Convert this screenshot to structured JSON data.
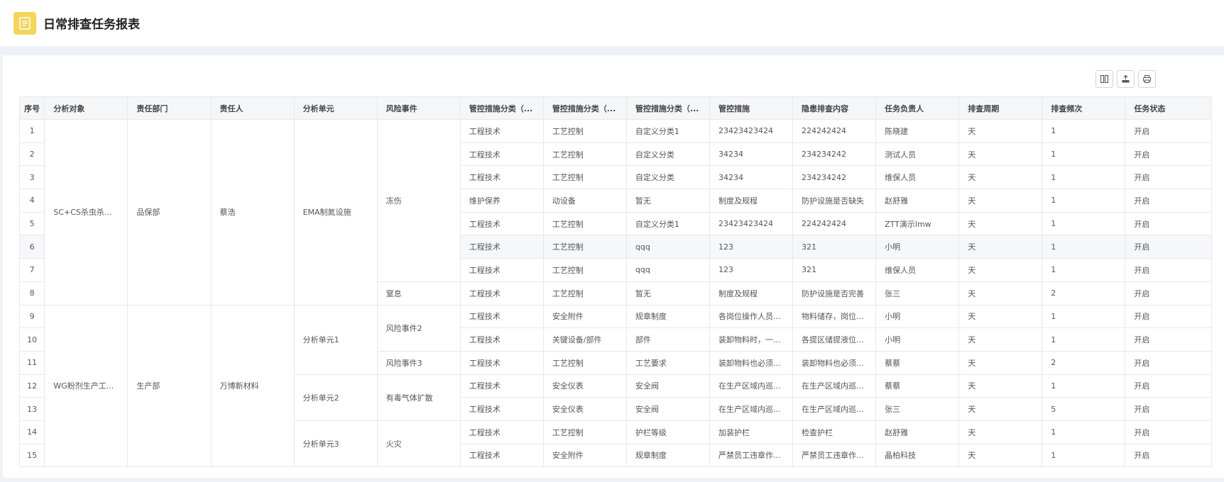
{
  "header": {
    "title": "日常排查任务报表",
    "icon": "report-document-icon"
  },
  "toolbar": {
    "buttons": [
      {
        "name": "column-settings-button",
        "icon": "columns-icon"
      },
      {
        "name": "export-button",
        "icon": "export-icon"
      },
      {
        "name": "print-button",
        "icon": "printer-icon"
      }
    ]
  },
  "colors": {
    "accent": "#f2d55a",
    "border": "#e6e8eb",
    "header_bg": "#f5f6f8",
    "highlight_row": "#f6f7fb"
  },
  "table": {
    "columns": [
      "序号",
      "分析对象",
      "责任部门",
      "责任人",
      "分析单元",
      "风险事件",
      "管控措施分类（...",
      "管控措施分类（...",
      "管控措施分类（...",
      "管控措施",
      "隐患排查内容",
      "任务负责人",
      "排查周期",
      "排查频次",
      "任务状态"
    ],
    "groups": [
      {
        "object": "SC+CS杀虫杀菌...",
        "dept": "品保部",
        "person": "蔡浩"
      },
      {
        "object": "WG粉剂生产工...",
        "dept": "生产部",
        "person": "万博新材料"
      }
    ],
    "units": [
      "EMA制氮设施",
      "分析单元1",
      "分析单元2",
      "分析单元3"
    ],
    "events": [
      "冻伤",
      "窒息",
      "风险事件2",
      "风险事件3",
      "有毒气体扩散",
      "火灾"
    ],
    "rows": [
      {
        "idx": "1",
        "c1": "工程技术",
        "c2": "工艺控制",
        "c3": "自定义分类1",
        "measure": "23423423424",
        "content": "224242424",
        "owner": "陈晓建",
        "cycle": "天",
        "freq": "1",
        "status": "开启"
      },
      {
        "idx": "2",
        "c1": "工程技术",
        "c2": "工艺控制",
        "c3": "自定义分类",
        "measure": "34234",
        "content": "234234242",
        "owner": "测试人员",
        "cycle": "天",
        "freq": "1",
        "status": "开启"
      },
      {
        "idx": "3",
        "c1": "工程技术",
        "c2": "工艺控制",
        "c3": "自定义分类",
        "measure": "34234",
        "content": "234234242",
        "owner": "维保人员",
        "cycle": "天",
        "freq": "1",
        "status": "开启"
      },
      {
        "idx": "4",
        "c1": "维护保养",
        "c2": "动设备",
        "c3": "暂无",
        "measure": "制度及规程",
        "content": "防护设施是否缺失",
        "owner": "赵舒雅",
        "cycle": "天",
        "freq": "1",
        "status": "开启"
      },
      {
        "idx": "5",
        "c1": "工程技术",
        "c2": "工艺控制",
        "c3": "自定义分类1",
        "measure": "23423423424",
        "content": "224242424",
        "owner": "ZTT演示lmw",
        "cycle": "天",
        "freq": "1",
        "status": "开启"
      },
      {
        "idx": "6",
        "c1": "工程技术",
        "c2": "工艺控制",
        "c3": "qqq",
        "measure": "123",
        "content": "321",
        "owner": "小明",
        "cycle": "天",
        "freq": "1",
        "status": "开启"
      },
      {
        "idx": "7",
        "c1": "工程技术",
        "c2": "工艺控制",
        "c3": "qqq",
        "measure": "123",
        "content": "321",
        "owner": "维保人员",
        "cycle": "天",
        "freq": "1",
        "status": "开启"
      },
      {
        "idx": "8",
        "c1": "工程技术",
        "c2": "工艺控制",
        "c3": "暂无",
        "measure": "制度及规程",
        "content": "防护设施是否完善",
        "owner": "张三",
        "cycle": "天",
        "freq": "2",
        "status": "开启"
      },
      {
        "idx": "9",
        "c1": "工程技术",
        "c2": "安全附件",
        "c3": "规章制度",
        "measure": "各岗位操作人员...",
        "content": "物料储存，岗位...",
        "owner": "小明",
        "cycle": "天",
        "freq": "1",
        "status": "开启"
      },
      {
        "idx": "10",
        "c1": "工程技术",
        "c2": "关键设备/部件",
        "c3": "部件",
        "measure": "装卸物料时，一...",
        "content": "各提区储提液位...",
        "owner": "小明",
        "cycle": "天",
        "freq": "1",
        "status": "开启"
      },
      {
        "idx": "11",
        "c1": "工程技术",
        "c2": "工艺控制",
        "c3": "工艺要求",
        "measure": "装卸物料也必须...",
        "content": "装卸物料也必须...",
        "owner": "蔡蔡",
        "cycle": "天",
        "freq": "2",
        "status": "开启"
      },
      {
        "idx": "12",
        "c1": "工程技术",
        "c2": "安全仪表",
        "c3": "安全阀",
        "measure": "在生产区域内巡...",
        "content": "在生产区域内巡...",
        "owner": "蔡蔡",
        "cycle": "天",
        "freq": "1",
        "status": "开启"
      },
      {
        "idx": "13",
        "c1": "工程技术",
        "c2": "安全仪表",
        "c3": "安全阀",
        "measure": "在生产区域内巡...",
        "content": "在生产区域内巡...",
        "owner": "张三",
        "cycle": "天",
        "freq": "5",
        "status": "开启"
      },
      {
        "idx": "14",
        "c1": "工程技术",
        "c2": "工艺控制",
        "c3": "护栏等级",
        "measure": "加装护栏",
        "content": "检查护栏",
        "owner": "赵舒雅",
        "cycle": "天",
        "freq": "1",
        "status": "开启"
      },
      {
        "idx": "15",
        "c1": "工程技术",
        "c2": "安全附件",
        "c3": "规章制度",
        "measure": "严禁员工违章作...",
        "content": "严禁员工违章作...",
        "owner": "晶柏科技",
        "cycle": "天",
        "freq": "1",
        "status": "开启"
      }
    ]
  }
}
